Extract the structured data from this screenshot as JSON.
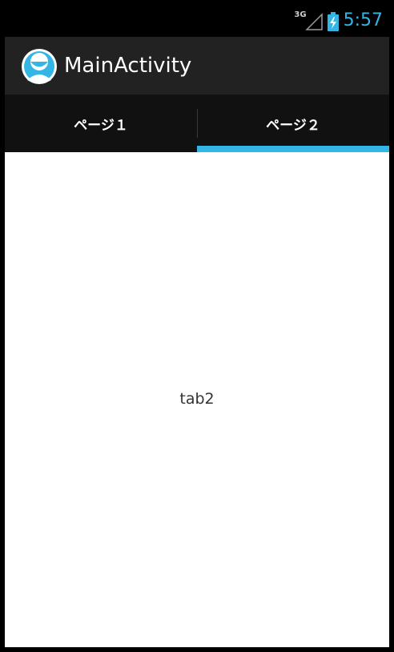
{
  "status_bar": {
    "network_type": "3G",
    "signal_icon": "signal-icon",
    "battery_icon": "battery-charging-icon",
    "time": "5:57",
    "accent_color": "#33b5e5"
  },
  "action_bar": {
    "app_icon": "android-face-icon",
    "title": "MainActivity"
  },
  "tabs": [
    {
      "label": "ページ１",
      "selected": false
    },
    {
      "label": "ページ２",
      "selected": true
    }
  ],
  "content": {
    "text": "tab2"
  }
}
